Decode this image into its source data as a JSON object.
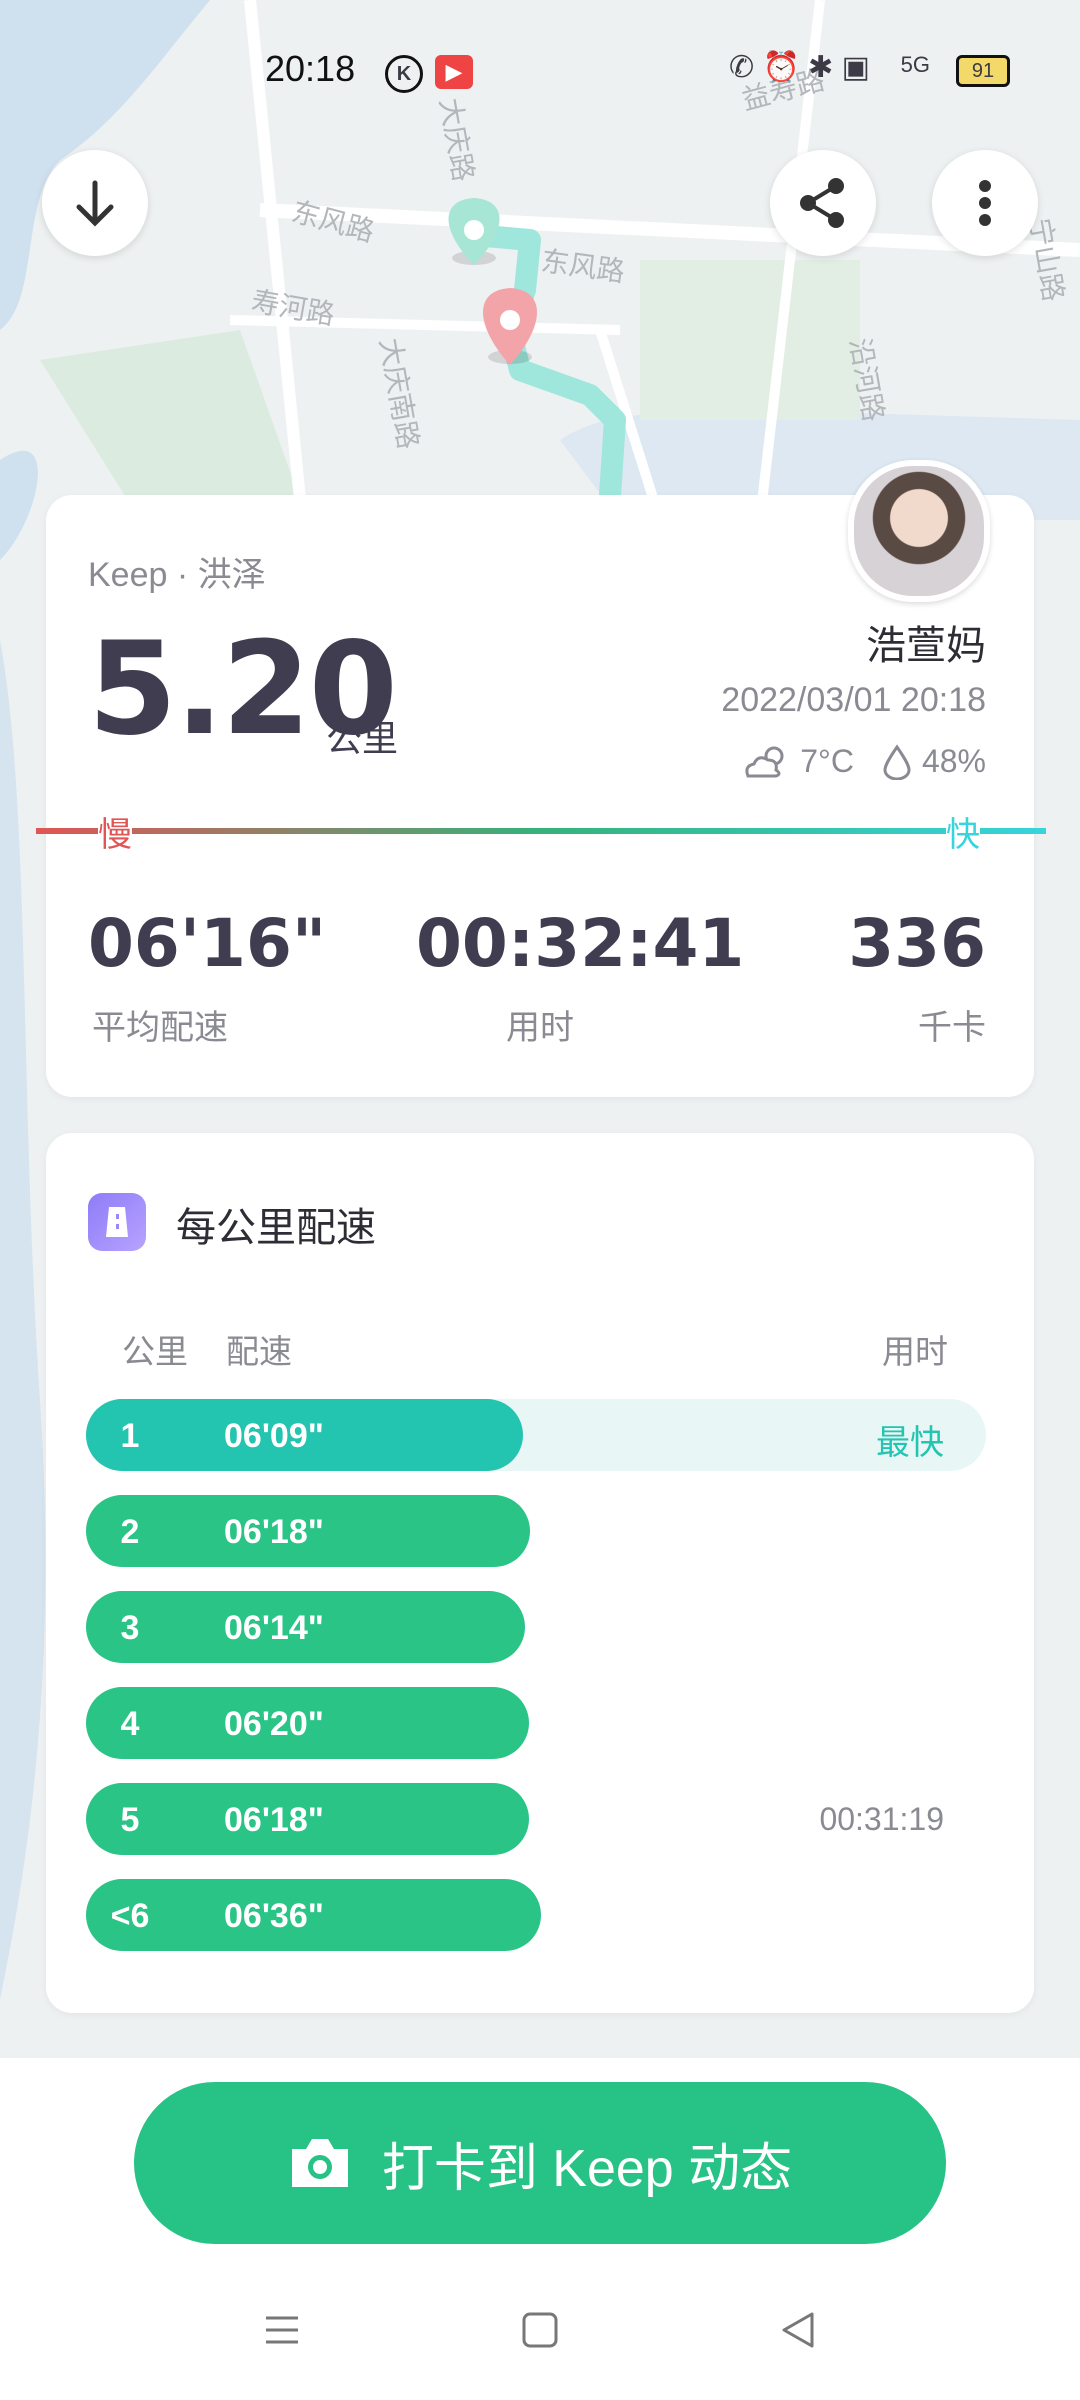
{
  "status_bar": {
    "time": "20:18",
    "battery": "91",
    "network": "5G"
  },
  "map": {
    "labels": [
      "东风路",
      "东风路",
      "寿河路",
      "大庆路",
      "大庆南路",
      "沿河路",
      "益寿路",
      "宁山路"
    ]
  },
  "summary": {
    "source": "Keep · 洪泽",
    "distance_value": "5.20",
    "distance_unit": "公里",
    "user_name": "浩萱妈",
    "datetime": "2022/03/01 20:18",
    "weather_temp": "7°C",
    "weather_humidity": "48%",
    "speed_slow": "慢",
    "speed_fast": "快",
    "stats": [
      {
        "value": "06'16\"",
        "label": "平均配速"
      },
      {
        "value": "00:32:41",
        "label": "用时"
      },
      {
        "value": "336",
        "label": "千卡"
      }
    ]
  },
  "pace_section": {
    "title": "每公里配速",
    "col_km": "公里",
    "col_pace": "配速",
    "col_time": "用时",
    "fastest_label": "最快",
    "rows": [
      {
        "km": "1",
        "pace": "06'09\"",
        "time": "",
        "fill": 0.485
      },
      {
        "km": "2",
        "pace": "06'18\"",
        "time": "",
        "fill": 0.493
      },
      {
        "km": "3",
        "pace": "06'14\"",
        "time": "",
        "fill": 0.488
      },
      {
        "km": "4",
        "pace": "06'20\"",
        "time": "",
        "fill": 0.492
      },
      {
        "km": "5",
        "pace": "06'18\"",
        "time": "00:31:19",
        "fill": 0.492
      },
      {
        "km": "<6",
        "pace": "06'36\"",
        "time": "",
        "fill": 0.505
      }
    ]
  },
  "cta": {
    "label": "打卡到 Keep 动态"
  },
  "colors": {
    "accent": "#26c286",
    "fastest_row": "#23c4b0",
    "slow": "#e05555",
    "fast": "#37d4dc"
  }
}
